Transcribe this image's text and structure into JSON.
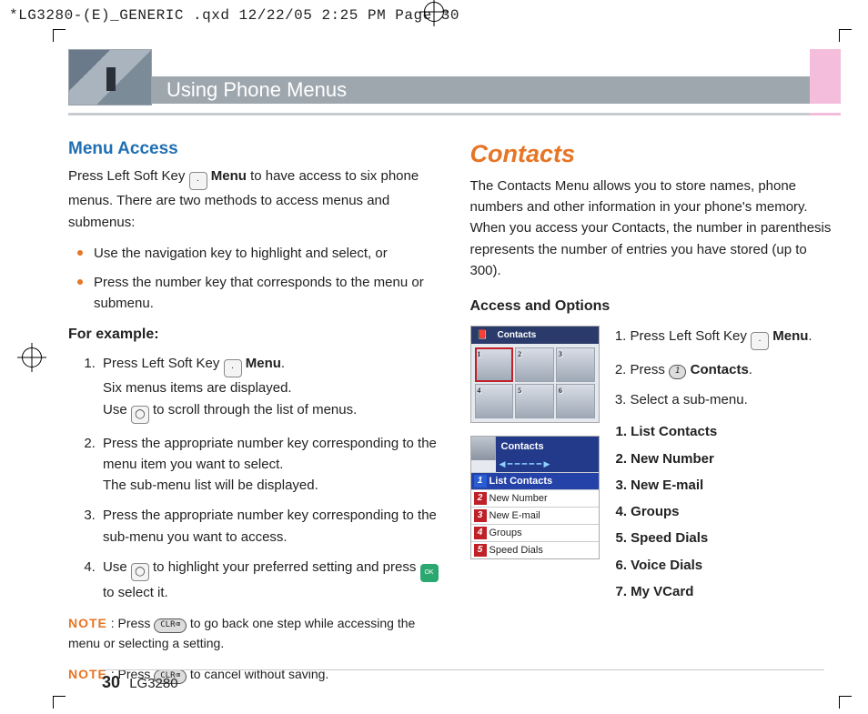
{
  "meta_header": "*LG3280-(E)_GENERIC .qxd  12/22/05  2:25 PM  Page 30",
  "banner_title": "Using Phone Menus",
  "left": {
    "h1": "Menu Access",
    "intro_a": "Press Left Soft Key ",
    "intro_b": " Menu",
    "intro_c": " to have access to six phone menus. There are two methods to access menus and submenus:",
    "bullets": [
      "Use the navigation key to highlight and select, or",
      "Press the number key that corresponds to the menu or submenu."
    ],
    "example_h": "For example:",
    "steps": [
      {
        "a": "Press Left Soft Key ",
        "b": " Menu",
        "c": ".",
        "d": "Six menus items are displayed.",
        "e": "Use ",
        "f": " to scroll through the list of menus."
      },
      {
        "a": "Press the appropriate number key corresponding to the menu item you want to select.",
        "d": "The sub-menu list will be displayed."
      },
      {
        "a": "Press the appropriate number key corresponding to the sub-menu you want to access."
      },
      {
        "a": "Use ",
        "b": " to highlight your preferred setting and press ",
        "c": " to select it."
      }
    ],
    "note1_lbl": "NOTE",
    "note1_a": " : Press ",
    "note1_b": " to go back one step while accessing the menu or selecting a setting.",
    "note2_lbl": "NOTE",
    "note2_a": " : Press ",
    "note2_b": " to cancel without saving.",
    "clr_key": "CLR⌫"
  },
  "right": {
    "h1": "Contacts",
    "intro": "The Contacts Menu allows you to store names, phone numbers and other information in your phone's memory. When you access your Contacts, the number in parenthesis represents the number of entries you have stored (up to 300).",
    "h2": "Access and Options",
    "screen1_title": "Contacts",
    "screen1_nums": [
      "1",
      "2",
      "3",
      "4",
      "5",
      "6"
    ],
    "screen2_title": "Contacts",
    "screen2_items": [
      "List Contacts",
      "New Number",
      "New E-mail",
      "Groups",
      "Speed Dials"
    ],
    "steps": [
      {
        "a": "Press Left Soft Key ",
        "b": " Menu",
        "c": "."
      },
      {
        "a": "Press ",
        "key": "1",
        "b": " Contacts",
        "c": "."
      },
      {
        "a": "Select a sub-menu."
      }
    ],
    "sublist": [
      "1.  List Contacts",
      "2.  New Number",
      "3.  New E-mail",
      "4.  Groups",
      "5.  Speed Dials",
      "6.  Voice Dials",
      "7.  My VCard"
    ]
  },
  "footer_page": "30",
  "footer_model": "LG3280"
}
